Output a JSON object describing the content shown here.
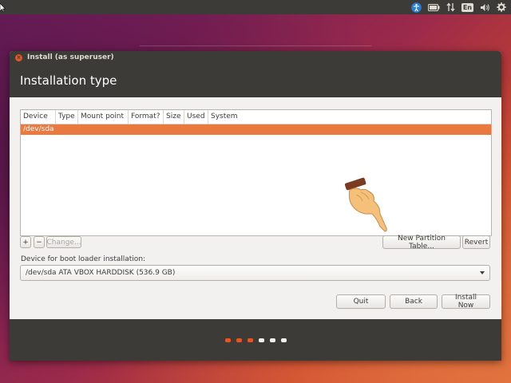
{
  "topbar": {
    "lang": "En",
    "icons": [
      "accessibility-icon",
      "battery-icon",
      "network-icon",
      "keyboard-lang-icon",
      "volume-icon",
      "settings-gear-icon"
    ]
  },
  "window": {
    "title": "Install (as superuser)",
    "heading": "Installation type"
  },
  "partition_table": {
    "columns": [
      "Device",
      "Type",
      "Mount point",
      "Format?",
      "Size",
      "Used",
      "System"
    ],
    "rows": [
      {
        "device": "/dev/sda"
      }
    ]
  },
  "table_buttons": {
    "add": "+",
    "remove": "−",
    "change": "Change...",
    "new_table": "New Partition Table...",
    "revert": "Revert"
  },
  "boot_loader": {
    "label": "Device for boot loader installation:",
    "selected": "/dev/sda ATA VBOX HARDDISK (536.9 GB)"
  },
  "actions": {
    "quit": "Quit",
    "back": "Back",
    "install": "Install Now"
  },
  "progress": {
    "total_steps": 6,
    "completed_steps": 3
  },
  "colors": {
    "accent": "#e95420",
    "selection": "#e9793f",
    "panel": "#3c3b37"
  }
}
